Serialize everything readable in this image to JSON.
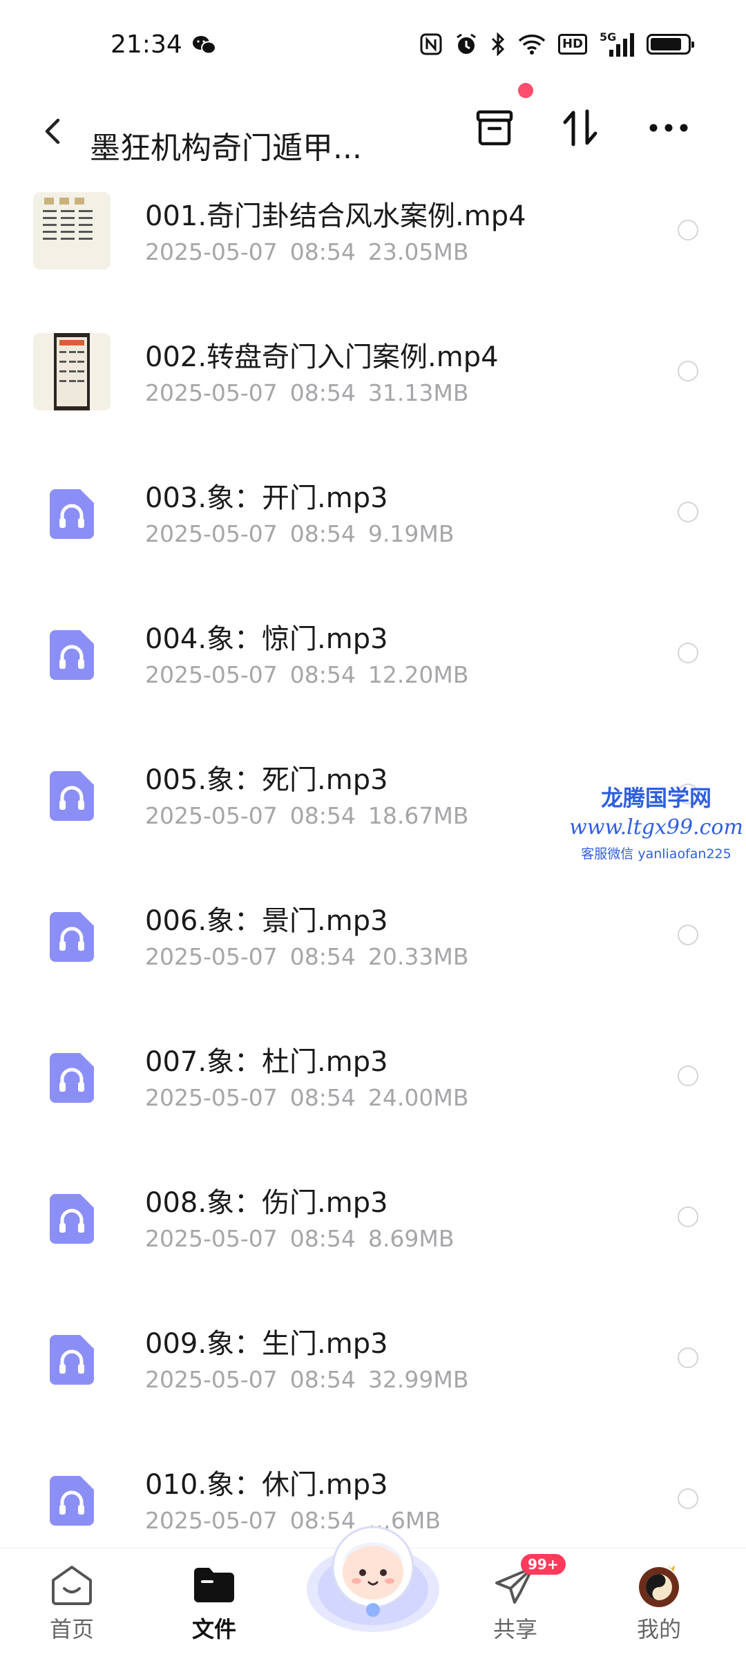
{
  "status_bar": {
    "time": "21:34",
    "icons": [
      "wechat-icon",
      "nfc-icon",
      "alarm-icon",
      "bluetooth-icon",
      "wifi-icon",
      "hd-icon",
      "signal-5g-icon",
      "battery-icon"
    ],
    "hd_label": "HD",
    "network_label": "5G"
  },
  "header": {
    "title": "墨狂机构奇门遁甲...",
    "actions": [
      "archive-icon",
      "sort-icon",
      "more-icon"
    ],
    "accent_dot_color": "#ff4d6d"
  },
  "files": [
    {
      "name": "001.奇门卦结合风水案例.mp4",
      "date": "2025-05-07",
      "time": "08:54",
      "size": "23.05MB",
      "type": "video"
    },
    {
      "name": "002.转盘奇门入门案例.mp4",
      "date": "2025-05-07",
      "time": "08:54",
      "size": "31.13MB",
      "type": "video"
    },
    {
      "name": "003.象：开门.mp3",
      "date": "2025-05-07",
      "time": "08:54",
      "size": "9.19MB",
      "type": "audio"
    },
    {
      "name": "004.象：惊门.mp3",
      "date": "2025-05-07",
      "time": "08:54",
      "size": "12.20MB",
      "type": "audio"
    },
    {
      "name": "005.象：死门.mp3",
      "date": "2025-05-07",
      "time": "08:54",
      "size": "18.67MB",
      "type": "audio"
    },
    {
      "name": "006.象：景门.mp3",
      "date": "2025-05-07",
      "time": "08:54",
      "size": "20.33MB",
      "type": "audio"
    },
    {
      "name": "007.象：杜门.mp3",
      "date": "2025-05-07",
      "time": "08:54",
      "size": "24.00MB",
      "type": "audio"
    },
    {
      "name": "008.象：伤门.mp3",
      "date": "2025-05-07",
      "time": "08:54",
      "size": "8.69MB",
      "type": "audio"
    },
    {
      "name": "009.象：生门.mp3",
      "date": "2025-05-07",
      "time": "08:54",
      "size": "32.99MB",
      "type": "audio"
    },
    {
      "name": "010.象：休门.mp3",
      "date": "2025-05-07",
      "time": "08:54",
      "size": "…6MB",
      "type": "audio"
    }
  ],
  "watermark": {
    "title": "龙腾国学网",
    "url": "www.ltgx99.com",
    "contact": "客服微信 yanliaofan225"
  },
  "bottom_nav": {
    "items": [
      {
        "label": "首页",
        "icon": "home-icon",
        "active": false
      },
      {
        "label": "文件",
        "icon": "folder-icon",
        "active": true
      },
      {
        "label": "共享",
        "icon": "share-icon",
        "active": false,
        "badge": "99+"
      },
      {
        "label": "我的",
        "icon": "profile-avatar-icon",
        "active": false
      }
    ],
    "assistant_icon": "ai-assistant-icon"
  },
  "colors": {
    "audio_icon": "#8b8ff5",
    "badge": "#ff3b5c",
    "meta_text": "#a6a6aa",
    "watermark": "#2f5fe0"
  }
}
